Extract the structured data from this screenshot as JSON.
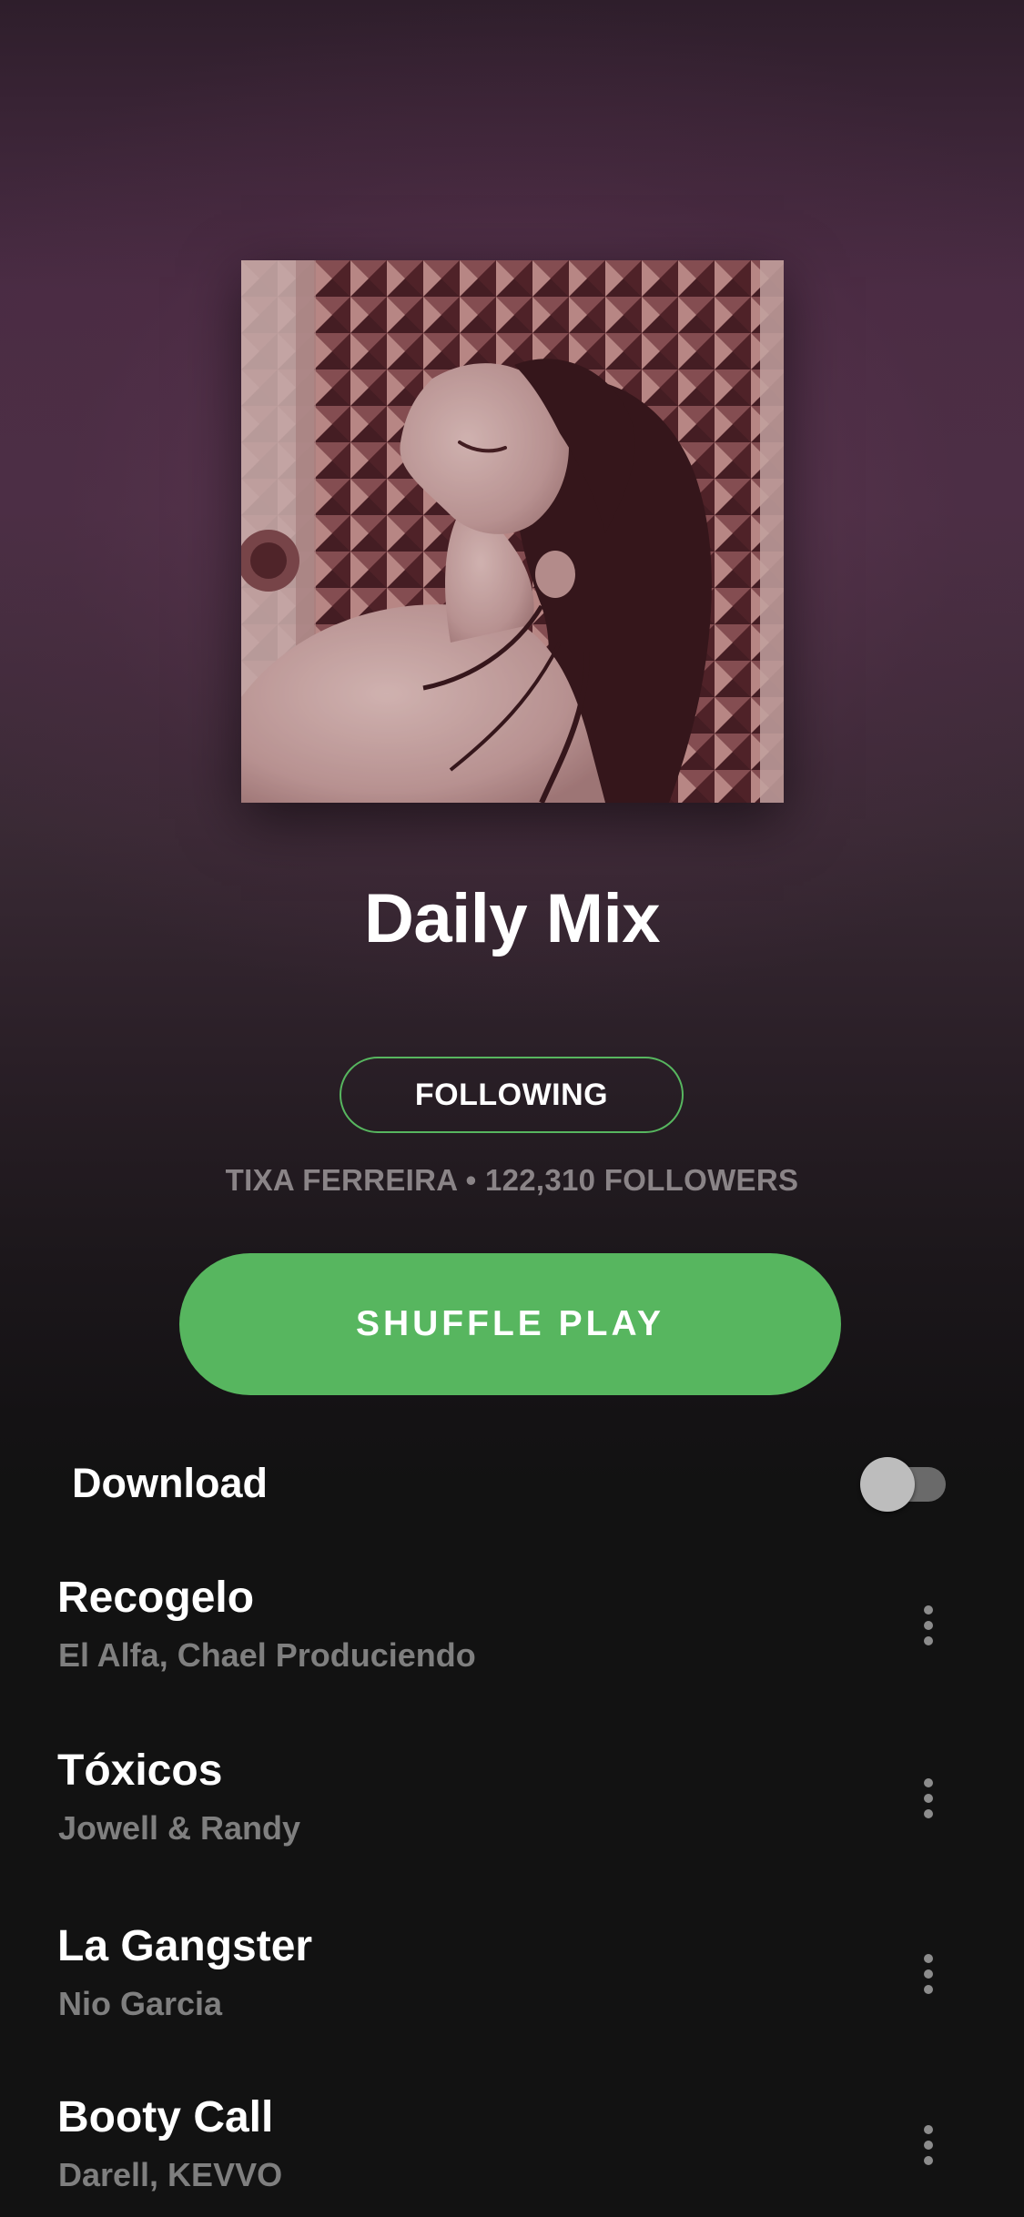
{
  "playlist": {
    "title": "Daily Mix",
    "follow_label": "FOLLOWING",
    "owner": "TIXA FERREIRA",
    "separator": "•",
    "followers": "122,310 FOLLOWERS",
    "shuffle_label": "SHUFFLE PLAY"
  },
  "download": {
    "label": "Download",
    "enabled": false
  },
  "tracks": [
    {
      "title": "Recogelo",
      "artist": "El Alfa, Chael Produciendo"
    },
    {
      "title": "Tóxicos",
      "artist": "Jowell & Randy"
    },
    {
      "title": "La Gangster",
      "artist": "Nio Garcia"
    },
    {
      "title": "Booty Call",
      "artist": "Darell, KEVVO"
    }
  ],
  "colors": {
    "accent_green": "#57b65f",
    "background": "#121212",
    "header_tint": "#4b2f45",
    "secondary_text": "#7f7f7f"
  },
  "icons": {
    "track_menu": "more-vertical-icon"
  }
}
